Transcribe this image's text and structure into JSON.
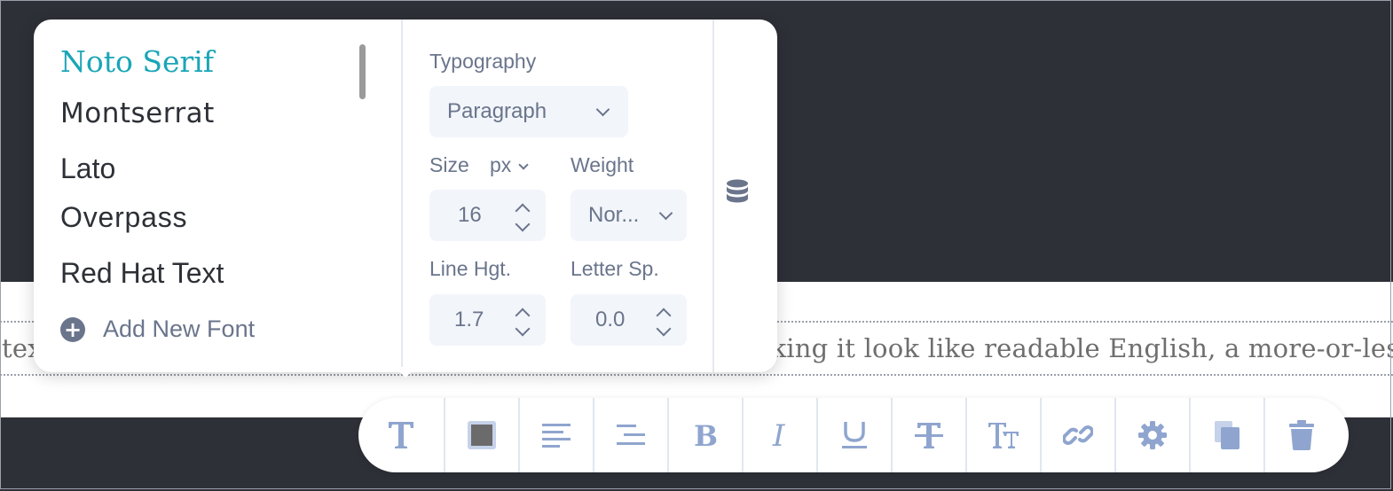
{
  "background": {
    "paragraph_text": "of text, as opposed to using 'Content here, content here', making it look like readable English, a more-or-less normal distribution of letters. mak"
  },
  "font_panel": {
    "fonts": [
      {
        "label": "Noto Serif",
        "active": true
      },
      {
        "label": "Montserrat",
        "active": false
      },
      {
        "label": "Lato",
        "active": false
      },
      {
        "label": "Overpass",
        "active": false
      },
      {
        "label": "Red Hat Text",
        "active": false
      }
    ],
    "add_new_font": "Add New Font",
    "add_icon": "plus-circle-icon"
  },
  "typography": {
    "title": "Typography",
    "style_select": "Paragraph",
    "size_label": "Size",
    "size_unit": "px",
    "size_value": "16",
    "weight_label": "Weight",
    "weight_value": "Nor...",
    "line_height_label": "Line Hgt.",
    "line_height_value": "1.7",
    "letter_spacing_label": "Letter Sp.",
    "letter_spacing_value": "0.0"
  },
  "side_icon": "database-icon",
  "toolbar": {
    "buttons": [
      {
        "name": "text-font",
        "icon": "text-t-icon"
      },
      {
        "name": "color",
        "icon": "color-swatch-icon"
      },
      {
        "name": "align-left",
        "icon": "align-left-icon"
      },
      {
        "name": "align-indent",
        "icon": "align-indent-icon"
      },
      {
        "name": "bold",
        "icon": "bold-icon"
      },
      {
        "name": "italic",
        "icon": "italic-icon"
      },
      {
        "name": "underline",
        "icon": "underline-icon"
      },
      {
        "name": "strikethrough",
        "icon": "strikethrough-icon"
      },
      {
        "name": "text-size",
        "icon": "text-size-icon"
      },
      {
        "name": "link",
        "icon": "link-icon"
      },
      {
        "name": "settings",
        "icon": "gear-icon"
      },
      {
        "name": "duplicate",
        "icon": "copy-icon"
      },
      {
        "name": "delete",
        "icon": "trash-icon"
      }
    ]
  },
  "colors": {
    "accent": "#1aa6b7",
    "icon": "#8fa5cf",
    "muted": "#6a758c",
    "dark_bg": "#2e3038",
    "swatch": "#6b6b6b"
  }
}
